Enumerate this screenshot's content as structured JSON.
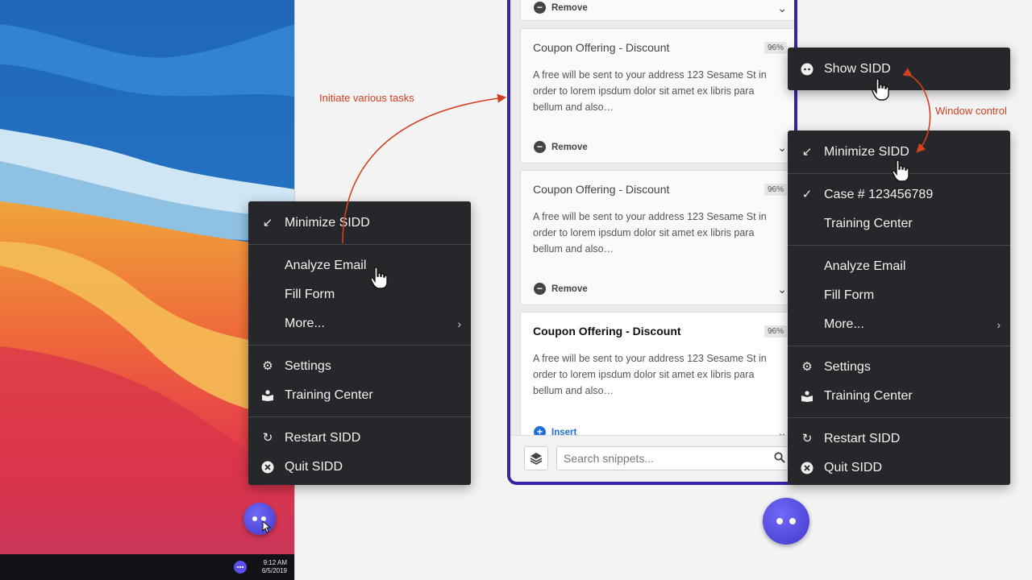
{
  "annotations": {
    "initiate_tasks": "Initiate various tasks",
    "window_control": "Window control"
  },
  "taskbar": {
    "time": "9:12 AM",
    "date": "6/5/2019"
  },
  "left_menu": {
    "minimize": "Minimize SIDD",
    "analyze": "Analyze Email",
    "fill": "Fill Form",
    "more": "More...",
    "settings": "Settings",
    "training": "Training Center",
    "restart": "Restart SIDD",
    "quit": "Quit SIDD"
  },
  "show_menu": {
    "show": "Show SIDD"
  },
  "right_menu": {
    "minimize": "Minimize SIDD",
    "case": "Case # 123456789",
    "training_top": "Training Center",
    "analyze": "Analyze Email",
    "fill": "Fill Form",
    "more": "More...",
    "settings": "Settings",
    "training": "Training Center",
    "restart": "Restart SIDD",
    "quit": "Quit SIDD"
  },
  "panel": {
    "top_partial_action": "Remove",
    "cards": [
      {
        "title": "Coupon Offering - Discount",
        "score": "96%",
        "body": "A free will be sent to your address 123 Sesame St in order to lorem ipsdum dolor sit amet ex libris para bellum and also…",
        "action": "Remove"
      },
      {
        "title": "Coupon Offering - Discount",
        "score": "96%",
        "body": "A free will be sent to your address 123 Sesame St in order to lorem ipsdum dolor sit amet ex libris para bellum and also…",
        "action": "Remove"
      },
      {
        "title": "Coupon Offering - Discount",
        "score": "96%",
        "body": "A free will be sent to your address 123 Sesame St in order to lorem ipsdum dolor sit amet ex libris para bellum and also…",
        "action": "Insert"
      }
    ],
    "search_placeholder": "Search snippets..."
  },
  "colors": {
    "accent": "#4f46e5",
    "annotation": "#d2401f",
    "menu_bg": "#26272b"
  }
}
